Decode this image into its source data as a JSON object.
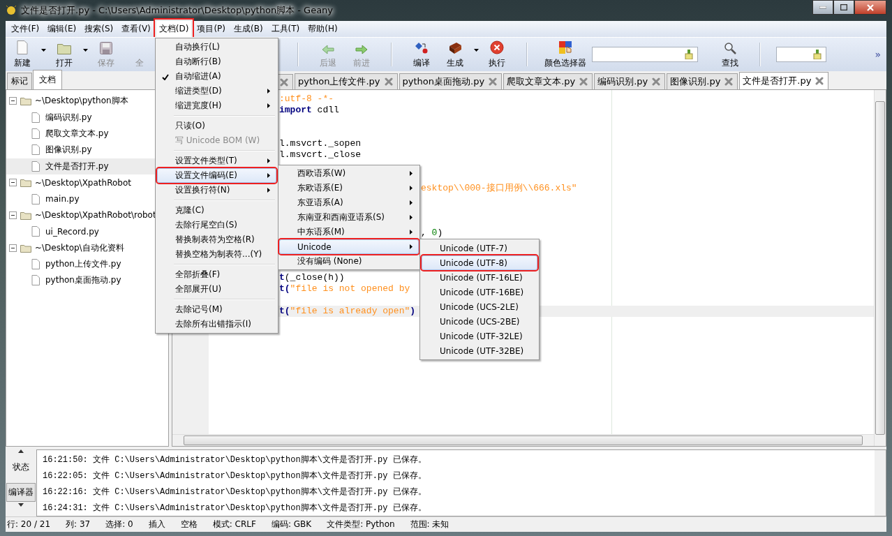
{
  "window": {
    "title": "文件是否打开.py - C:\\Users\\Administrator\\Desktop\\python脚本 - Geany"
  },
  "menubar": [
    {
      "label": "文件(F)",
      "selected": false,
      "annotated": false
    },
    {
      "label": "编辑(E)",
      "selected": false,
      "annotated": false
    },
    {
      "label": "搜索(S)",
      "selected": false,
      "annotated": false
    },
    {
      "label": "查看(V)",
      "selected": false,
      "annotated": false
    },
    {
      "label": "文档(D)",
      "selected": true,
      "annotated": true
    },
    {
      "label": "项目(P)",
      "selected": false,
      "annotated": false
    },
    {
      "label": "生成(B)",
      "selected": false,
      "annotated": false
    },
    {
      "label": "工具(T)",
      "selected": false,
      "annotated": false
    },
    {
      "label": "帮助(H)",
      "selected": false,
      "annotated": false
    }
  ],
  "toolbar": {
    "left": [
      {
        "kind": "button",
        "label": "新建",
        "disabled": false
      },
      {
        "kind": "dropdown"
      },
      {
        "kind": "button",
        "label": "打开",
        "disabled": false
      },
      {
        "kind": "dropdown"
      },
      {
        "kind": "button",
        "label": "保存",
        "disabled": true
      },
      {
        "kind": "button",
        "label": "全",
        "disabled": true
      }
    ],
    "right": [
      {
        "kind": "separator"
      },
      {
        "kind": "button",
        "label": "后退",
        "disabled": true
      },
      {
        "kind": "button",
        "label": "前进",
        "disabled": true
      },
      {
        "kind": "separator"
      },
      {
        "kind": "button",
        "label": "编译",
        "disabled": false
      },
      {
        "kind": "button",
        "label": "生成",
        "disabled": false
      },
      {
        "kind": "dropdown"
      },
      {
        "kind": "button",
        "label": "执行",
        "disabled": false
      },
      {
        "kind": "separator"
      },
      {
        "kind": "button",
        "label": "颜色选择器",
        "disabled": false
      },
      {
        "kind": "field"
      },
      {
        "kind": "button",
        "label": "查找",
        "disabled": false
      },
      {
        "kind": "separator"
      },
      {
        "kind": "field"
      },
      {
        "kind": "overflow",
        "label": "»"
      }
    ]
  },
  "sidebar": {
    "tabs": [
      {
        "label": "标记",
        "selected": false
      },
      {
        "label": "文档",
        "selected": true
      }
    ],
    "tree": [
      {
        "label": "~\\Desktop\\python脚本",
        "expanded": true,
        "children": [
          {
            "label": "编码识别.py",
            "selected": false
          },
          {
            "label": "爬取文章文本.py",
            "selected": false
          },
          {
            "label": "图像识别.py",
            "selected": false
          },
          {
            "label": "文件是否打开.py",
            "selected": true
          }
        ]
      },
      {
        "label": "~\\Desktop\\XpathRobot",
        "expanded": true,
        "children": [
          {
            "label": "main.py",
            "selected": false
          }
        ]
      },
      {
        "label": "~\\Desktop\\XpathRobot\\robot",
        "expanded": true,
        "children": [
          {
            "label": "ui_Record.py",
            "selected": false
          }
        ]
      },
      {
        "label": "~\\Desktop\\自动化资料",
        "expanded": true,
        "children": [
          {
            "label": "python上传文件.py",
            "selected": false
          },
          {
            "label": "python桌面拖动.py",
            "selected": false
          }
        ]
      }
    ]
  },
  "editor": {
    "tabs": [
      {
        "selected": false
      },
      {
        "label": "python上传文件.py",
        "selected": false
      },
      {
        "label": "python桌面拖动.py",
        "selected": false
      },
      {
        "label": "爬取文章文本.py",
        "selected": false
      },
      {
        "label": "编码识别.py",
        "selected": false
      },
      {
        "label": "图像识别.py",
        "selected": false
      },
      {
        "label": "文件是否打开.py",
        "selected": true
      }
    ],
    "lines": [
      {
        "kind": "after-menu",
        "current": false,
        "segments": [
          {
            "kind": "comment",
            "text": ":utf-8 -*-"
          }
        ]
      },
      {
        "kind": "after-menu",
        "current": false,
        "segments": [
          {
            "kind": "keyword",
            "text": "import"
          },
          {
            "kind": "plain",
            "text": " cdll"
          }
        ]
      },
      {
        "kind": "hidden",
        "current": false
      },
      {
        "kind": "hidden",
        "current": false
      },
      {
        "kind": "after-menu",
        "current": false,
        "segments": [
          {
            "kind": "plain",
            "text": "l.msvcrt._sopen"
          }
        ]
      },
      {
        "kind": "after-menu",
        "current": false,
        "segments": [
          {
            "kind": "plain",
            "text": "l.msvcrt._close"
          }
        ]
      },
      {
        "kind": "hidden",
        "current": false
      },
      {
        "kind": "hidden",
        "current": false
      },
      {
        "kind": "after-submenu",
        "current": false,
        "segments": [
          {
            "kind": "string",
            "text": "esktop\\\\000-接口用例\\\\666.xls\""
          }
        ]
      },
      {
        "kind": "hidden",
        "current": false
      },
      {
        "kind": "hidden",
        "current": false
      },
      {
        "kind": "hidden",
        "current": false
      },
      {
        "kind": "after-submenu",
        "current": false,
        "segments": [
          {
            "kind": "plain",
            "text": ", "
          },
          {
            "kind": "number",
            "text": "0"
          },
          {
            "kind": "plain",
            "text": ")"
          }
        ]
      },
      {
        "kind": "hidden",
        "current": false
      },
      {
        "kind": "hidden",
        "current": false
      },
      {
        "kind": "hidden",
        "current": false
      },
      {
        "kind": "after-menu",
        "current": false,
        "segments": [
          {
            "kind": "keyword",
            "text": "t"
          },
          {
            "kind": "plain",
            "text": "(_close(h))"
          }
        ]
      },
      {
        "kind": "after-menu",
        "current": false,
        "segments": [
          {
            "kind": "keyword",
            "text": "t("
          },
          {
            "kind": "string",
            "text": "\"file is not opened by"
          }
        ]
      },
      {
        "kind": "hidden",
        "current": false
      },
      {
        "kind": "after-menu",
        "current": true,
        "segments": [
          {
            "kind": "keyword",
            "text": "t("
          },
          {
            "kind": "string",
            "text": "\"file is already open\""
          },
          {
            "kind": "keyword",
            "text": ")"
          }
        ]
      },
      {
        "kind": "hidden",
        "current": false
      }
    ]
  },
  "document_menu": [
    {
      "kind": "check",
      "label": "自动换行(L)",
      "checked": false,
      "selected": false,
      "annotated": false,
      "disabled": false
    },
    {
      "kind": "check",
      "label": "自动断行(B)",
      "checked": false,
      "selected": false,
      "annotated": false,
      "disabled": false
    },
    {
      "kind": "check",
      "label": "自动缩进(A)",
      "checked": true,
      "selected": false,
      "annotated": false,
      "disabled": false
    },
    {
      "kind": "submenu",
      "label": "缩进类型(D)",
      "selected": false,
      "annotated": false,
      "disabled": false
    },
    {
      "kind": "submenu",
      "label": "缩进宽度(H)",
      "selected": false,
      "annotated": false,
      "disabled": false
    },
    {
      "kind": "separator"
    },
    {
      "kind": "check",
      "label": "只读(O)",
      "checked": false,
      "selected": false,
      "annotated": false,
      "disabled": false
    },
    {
      "kind": "check",
      "label": "写 Unicode BOM (W)",
      "checked": false,
      "selected": false,
      "annotated": false,
      "disabled": true
    },
    {
      "kind": "separator"
    },
    {
      "kind": "submenu",
      "label": "设置文件类型(T)",
      "selected": false,
      "annotated": false,
      "disabled": false
    },
    {
      "kind": "submenu",
      "label": "设置文件编码(E)",
      "selected": true,
      "annotated": true,
      "disabled": false
    },
    {
      "kind": "submenu",
      "label": "设置换行符(N)",
      "selected": false,
      "annotated": false,
      "disabled": false
    },
    {
      "kind": "separator"
    },
    {
      "kind": "item",
      "label": "克隆(C)",
      "selected": false,
      "annotated": false,
      "disabled": false
    },
    {
      "kind": "item",
      "label": "去除行尾空白(S)",
      "selected": false,
      "annotated": false,
      "disabled": false
    },
    {
      "kind": "item",
      "label": "替换制表符为空格(R)",
      "selected": false,
      "annotated": false,
      "disabled": false
    },
    {
      "kind": "item",
      "label": "替换空格为制表符...(Y)",
      "selected": false,
      "annotated": false,
      "disabled": false
    },
    {
      "kind": "separator"
    },
    {
      "kind": "item",
      "label": "全部折叠(F)",
      "selected": false,
      "annotated": false,
      "disabled": false
    },
    {
      "kind": "item",
      "label": "全部展开(U)",
      "selected": false,
      "annotated": false,
      "disabled": false
    },
    {
      "kind": "separator"
    },
    {
      "kind": "item",
      "label": "去除记号(M)",
      "selected": false,
      "annotated": false,
      "disabled": false
    },
    {
      "kind": "item",
      "label": "去除所有出错指示(I)",
      "selected": false,
      "annotated": false,
      "disabled": false
    }
  ],
  "encoding_menu": [
    {
      "kind": "submenu",
      "label": "西欧语系(W)",
      "selected": false,
      "annotated": false,
      "disabled": false
    },
    {
      "kind": "submenu",
      "label": "东欧语系(E)",
      "selected": false,
      "annotated": false,
      "disabled": false
    },
    {
      "kind": "submenu",
      "label": "东亚语系(A)",
      "selected": false,
      "annotated": false,
      "disabled": false
    },
    {
      "kind": "submenu",
      "label": "东南亚和西南亚语系(S)",
      "selected": false,
      "annotated": false,
      "disabled": false
    },
    {
      "kind": "submenu",
      "label": "中东语系(M)",
      "selected": false,
      "annotated": false,
      "disabled": false
    },
    {
      "kind": "submenu",
      "label": "Unicode",
      "selected": true,
      "annotated": true,
      "disabled": false
    },
    {
      "kind": "item",
      "label": "没有编码 (None)",
      "selected": false,
      "annotated": false,
      "disabled": false
    }
  ],
  "unicode_menu": [
    {
      "kind": "item",
      "label": "Unicode (UTF-7)",
      "selected": false,
      "annotated": false,
      "disabled": false
    },
    {
      "kind": "item",
      "label": "Unicode (UTF-8)",
      "selected": true,
      "annotated": true,
      "disabled": false
    },
    {
      "kind": "item",
      "label": "Unicode (UTF-16LE)",
      "selected": false,
      "annotated": false,
      "disabled": false
    },
    {
      "kind": "item",
      "label": "Unicode (UTF-16BE)",
      "selected": false,
      "annotated": false,
      "disabled": false
    },
    {
      "kind": "item",
      "label": "Unicode (UCS-2LE)",
      "selected": false,
      "annotated": false,
      "disabled": false
    },
    {
      "kind": "item",
      "label": "Unicode (UCS-2BE)",
      "selected": false,
      "annotated": false,
      "disabled": false
    },
    {
      "kind": "item",
      "label": "Unicode (UTF-32LE)",
      "selected": false,
      "annotated": false,
      "disabled": false
    },
    {
      "kind": "item",
      "label": "Unicode (UTF-32BE)",
      "selected": false,
      "annotated": false,
      "disabled": false
    }
  ],
  "message_panel": {
    "tabs": [
      {
        "label": "状态",
        "selected": true
      },
      {
        "label": "编译器",
        "selected": false
      }
    ],
    "lines": [
      "16:21:50: 文件 C:\\Users\\Administrator\\Desktop\\python脚本\\文件是否打开.py 已保存。",
      "16:22:05: 文件 C:\\Users\\Administrator\\Desktop\\python脚本\\文件是否打开.py 已保存。",
      "16:22:16: 文件 C:\\Users\\Administrator\\Desktop\\python脚本\\文件是否打开.py 已保存。",
      "16:24:31: 文件 C:\\Users\\Administrator\\Desktop\\python脚本\\文件是否打开.py 已保存。"
    ]
  },
  "status_bar": [
    "行: 20 / 21",
    "列: 37",
    "选择: 0",
    "插入",
    "空格",
    "模式: CRLF",
    "编码: GBK",
    "文件类型: Python",
    "范围: 未知"
  ]
}
